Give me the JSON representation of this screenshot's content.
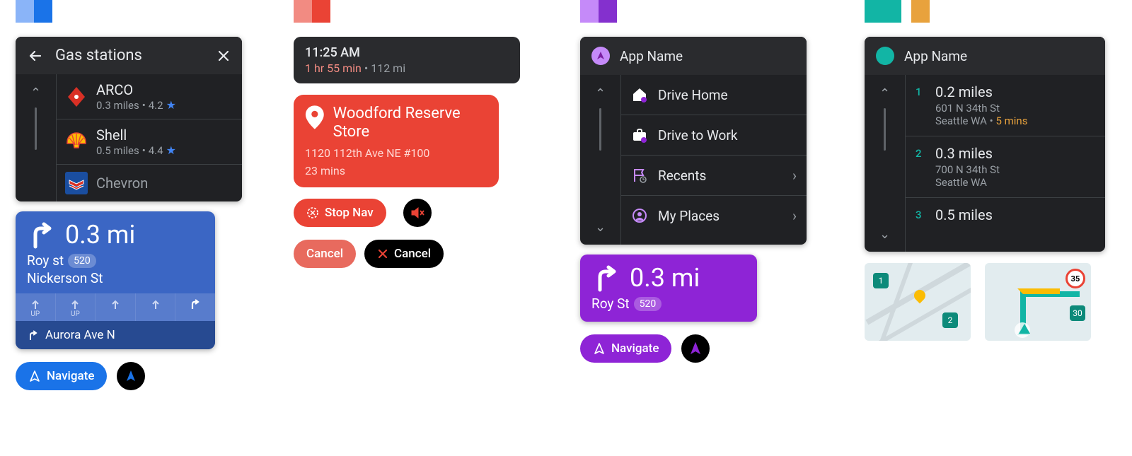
{
  "blue": {
    "header": "Gas stations",
    "items": [
      {
        "name": "ARCO",
        "dist": "0.3 miles",
        "rating": "4.2"
      },
      {
        "name": "Shell",
        "dist": "0.5 miles",
        "rating": "4.4"
      },
      {
        "name": "Chevron",
        "dist": "",
        "rating": ""
      }
    ],
    "nav": {
      "distance": "0.3 mi",
      "street1": "Roy st",
      "badge": "520",
      "street2": "Nickerson St",
      "lane_up": "UP",
      "next_step": "Aurora Ave N"
    },
    "navigate_label": "Navigate"
  },
  "red": {
    "time": "11:25 AM",
    "eta": "1 hr 55 min",
    "dist": "112 mi",
    "dest_name": "Woodford Reserve Store",
    "dest_addr": "1120 112th Ave NE #100",
    "dest_eta": "23 mins",
    "stop_label": "Stop Nav",
    "cancel_label": "Cancel",
    "cancel_label2": "Cancel"
  },
  "purple": {
    "app_name": "App Name",
    "menu": [
      {
        "label": "Drive Home"
      },
      {
        "label": "Drive to Work"
      },
      {
        "label": "Recents"
      },
      {
        "label": "My Places"
      }
    ],
    "nav": {
      "distance": "0.3 mi",
      "street": "Roy St",
      "badge": "520"
    },
    "navigate_label": "Navigate"
  },
  "teal": {
    "app_name": "App Name",
    "results": [
      {
        "n": "1",
        "dist": "0.2 miles",
        "addr": "601 N 34th St",
        "city": "Seattle WA",
        "eta": "5 mins"
      },
      {
        "n": "2",
        "dist": "0.3 miles",
        "addr": "700 N 34th St",
        "city": "Seattle WA",
        "eta": ""
      },
      {
        "n": "3",
        "dist": "0.5 miles",
        "addr": "",
        "city": "",
        "eta": ""
      }
    ],
    "pins": {
      "p1": "1",
      "p2": "2",
      "speed": "35",
      "p30": "30"
    }
  },
  "sep": " • "
}
